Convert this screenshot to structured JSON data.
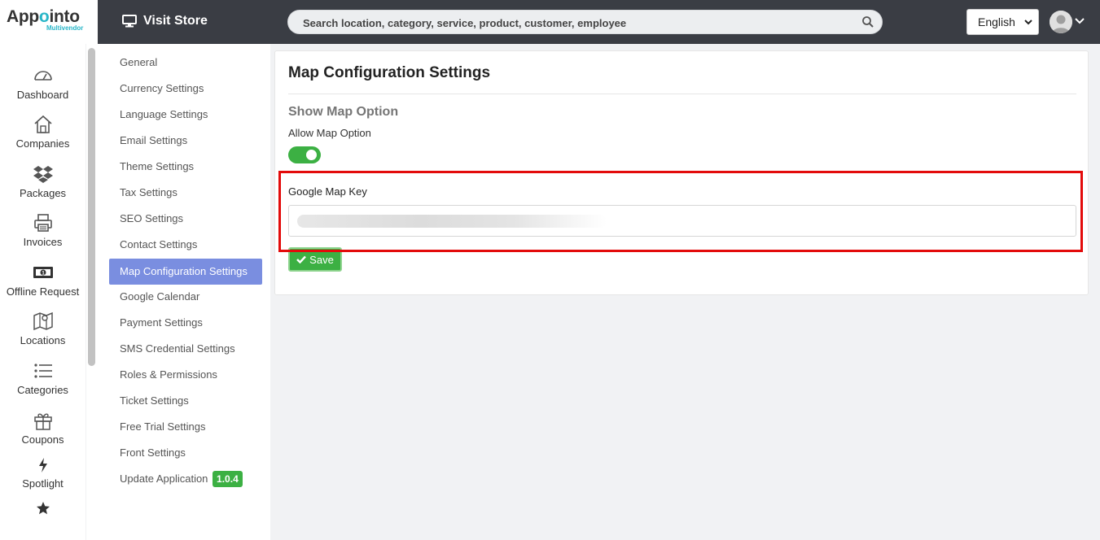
{
  "brand": {
    "name_pre": "App",
    "name_acc": "o",
    "name_post": "into",
    "sub": "Multivendor"
  },
  "header": {
    "visit_store": "Visit Store",
    "search_placeholder": "Search location, category, service, product, customer, employee",
    "language": "English"
  },
  "left_nav": [
    {
      "label": "Dashboard",
      "icon": "dashboard-icon"
    },
    {
      "label": "Companies",
      "icon": "home-icon"
    },
    {
      "label": "Packages",
      "icon": "dropbox-icon"
    },
    {
      "label": "Invoices",
      "icon": "printer-icon"
    },
    {
      "label": "Offline Request",
      "icon": "money-icon"
    },
    {
      "label": "Locations",
      "icon": "map-icon"
    },
    {
      "label": "Categories",
      "icon": "list-icon"
    },
    {
      "label": "Coupons",
      "icon": "gift-icon"
    },
    {
      "label": "Spotlight",
      "icon": "bolt-icon"
    },
    {
      "label": "",
      "icon": "star-icon"
    }
  ],
  "settings_menu": [
    "General",
    "Currency Settings",
    "Language Settings",
    "Email Settings",
    "Theme Settings",
    "Tax Settings",
    "SEO Settings",
    "Contact Settings",
    "Map Configuration Settings",
    "Google Calendar",
    "Payment Settings",
    "SMS Credential Settings",
    "Roles & Permissions",
    "Ticket Settings",
    "Free Trial Settings",
    "Front Settings",
    "Update Application"
  ],
  "settings_active": "Map Configuration Settings",
  "version_badge": "1.0.4",
  "main": {
    "title": "Map Configuration Settings",
    "section_title": "Show Map Option",
    "allow_label": "Allow Map Option",
    "allow_enabled": true,
    "key_label": "Google Map Key",
    "key_value": "",
    "save_label": "Save"
  },
  "colors": {
    "accent": "#3cb043",
    "menu_active": "#7a8ee0",
    "topbar": "#3a3d44",
    "highlight": "#e30b0b"
  }
}
